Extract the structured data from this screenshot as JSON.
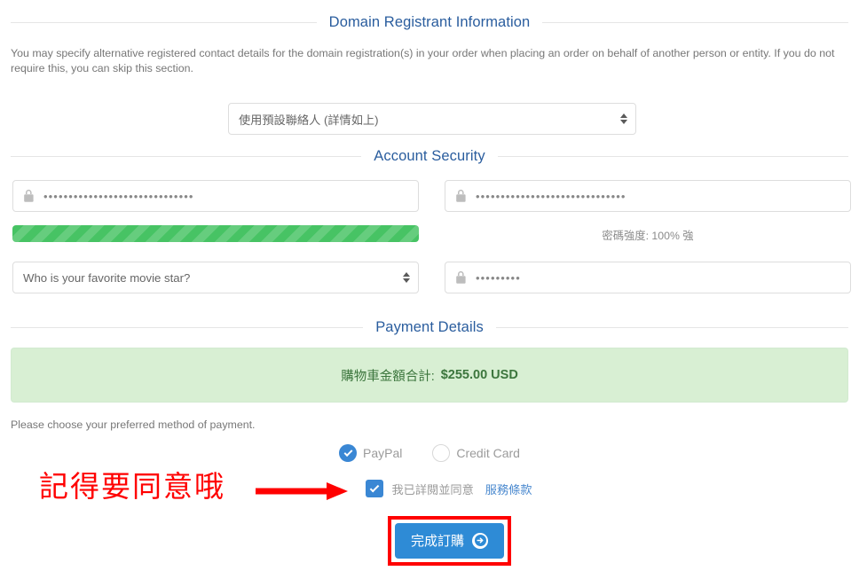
{
  "sections": {
    "domain": {
      "title": "Domain Registrant Information",
      "description": "You may specify alternative registered contact details for the domain registration(s) in your order when placing an order on behalf of another person or entity. If you do not require this, you can skip this section.",
      "contact_select": {
        "value": "使用預設聯絡人 (詳情如上)",
        "icon": "spinner-arrows-icon"
      }
    },
    "account_security": {
      "title": "Account Security",
      "password": {
        "value": "••••••••••••••••••••••••••••••",
        "icon": "lock-icon"
      },
      "confirm_password": {
        "value": "••••••••••••••••••••••••••••••",
        "icon": "lock-icon"
      },
      "strength": {
        "percent": 100,
        "label": "密碼強度: 100% 強",
        "bar_color": "#47c364"
      },
      "security_question": {
        "value": "Who is your favorite movie star?",
        "icon": "spinner-arrows-icon"
      },
      "security_answer": {
        "value": "•••••••••",
        "icon": "lock-icon"
      }
    },
    "payment": {
      "title": "Payment Details",
      "total_label": "購物車金額合計:",
      "total_amount": "$255.00 USD",
      "total_bg": "#d8efd3",
      "total_color": "#3c763d",
      "choose_text": "Please choose your preferred method of payment.",
      "methods": [
        {
          "label": "PayPal",
          "selected": true,
          "icon": "radio-checked-icon"
        },
        {
          "label": "Credit Card",
          "selected": false,
          "icon": "radio-unchecked-icon"
        }
      ],
      "terms": {
        "checked": true,
        "icon": "checkbox-checked-icon",
        "text": "我已詳閱並同意",
        "link": "服務條款"
      },
      "submit": {
        "label": "完成訂購",
        "icon": "arrow-right-circle-icon",
        "color": "#2e8bd6"
      }
    }
  },
  "annotations": {
    "note_text": "記得要同意哦",
    "note_color": "#ff0000",
    "arrow_icon": "arrow-right-icon",
    "highlight_color": "#ff0000"
  }
}
